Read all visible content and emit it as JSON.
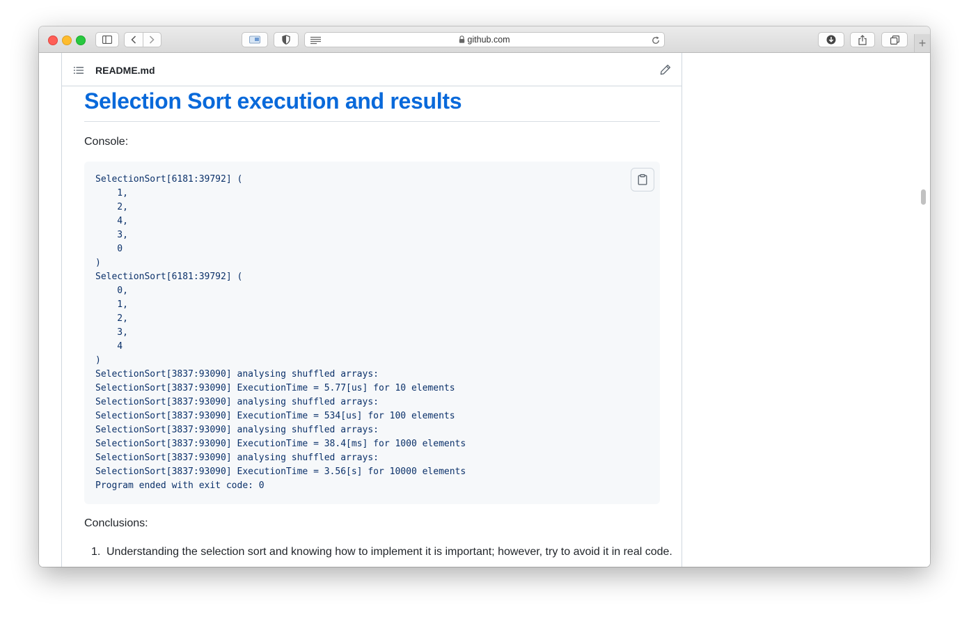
{
  "browser": {
    "url": "github.com",
    "new_tab_symbol": "+"
  },
  "readme": {
    "filename": "README.md",
    "heading": "Selection Sort execution and results",
    "console_label": "Console:",
    "code": "SelectionSort[6181:39792] (\n    1,\n    2,\n    4,\n    3,\n    0\n)\nSelectionSort[6181:39792] (\n    0,\n    1,\n    2,\n    3,\n    4\n)\nSelectionSort[3837:93090] analysing shuffled arrays:\nSelectionSort[3837:93090] ExecutionTime = 5.77[us] for 10 elements\nSelectionSort[3837:93090] analysing shuffled arrays:\nSelectionSort[3837:93090] ExecutionTime = 534[us] for 100 elements\nSelectionSort[3837:93090] analysing shuffled arrays:\nSelectionSort[3837:93090] ExecutionTime = 38.4[ms] for 1000 elements\nSelectionSort[3837:93090] analysing shuffled arrays:\nSelectionSort[3837:93090] ExecutionTime = 3.56[s] for 10000 elements\nProgram ended with exit code: 0",
    "conclusions_label": "Conclusions:",
    "conclusions": [
      {
        "number": "1.",
        "text": "Understanding the selection sort and knowing how to implement it is important; however, try to avoid it in real code."
      }
    ]
  },
  "icons": {
    "sidebar": "sidebar-icon",
    "back": "chevron-left-icon",
    "forward": "chevron-right-icon",
    "extension": "extension-icon",
    "privacy": "shield-icon",
    "reader": "reader-icon",
    "lock": "lock-icon",
    "reload": "reload-icon",
    "downloads": "download-icon",
    "share": "share-icon",
    "tabs": "tabs-icon",
    "list": "list-icon",
    "edit": "pencil-icon",
    "copy": "clipboard-icon"
  },
  "colors": {
    "heading": "#0969da",
    "code_text": "#0a3069",
    "code_bg": "#f6f8fa"
  }
}
